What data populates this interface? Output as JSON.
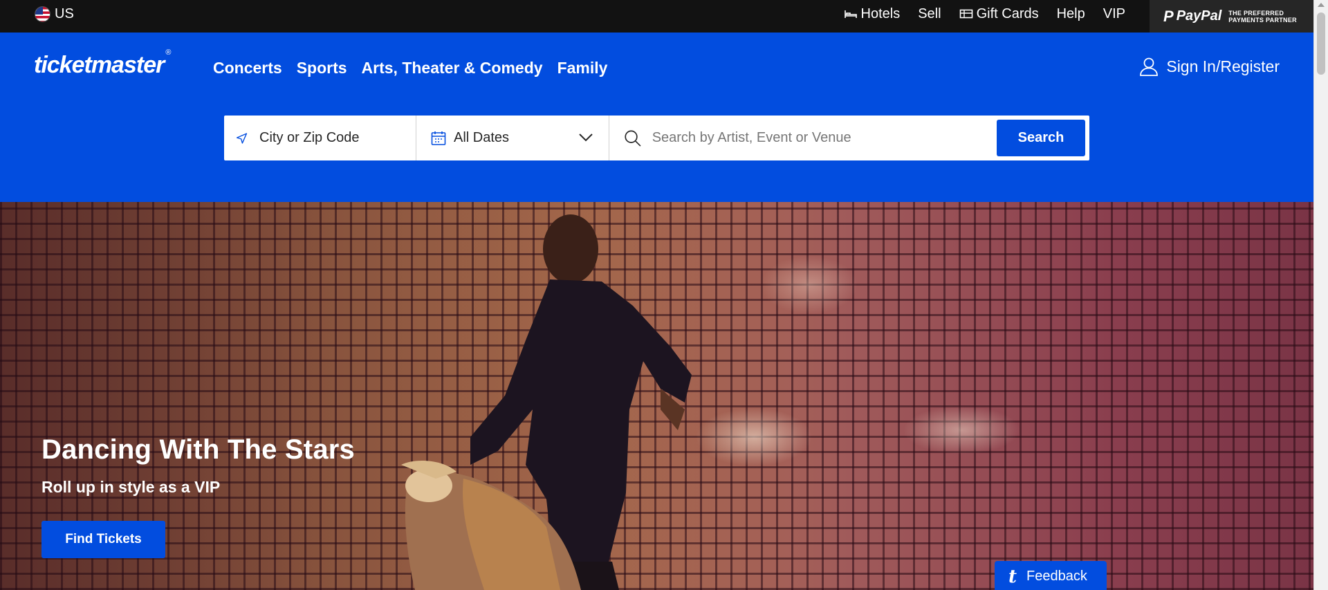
{
  "topbar": {
    "locale": "US",
    "links": [
      "Hotels",
      "Sell",
      "Gift Cards",
      "Help",
      "VIP"
    ],
    "paypal": {
      "logo": "PayPal",
      "tagline_1": "THE PREFERRED",
      "tagline_2": "PAYMENTS PARTNER"
    }
  },
  "header": {
    "logo": "ticketmaster",
    "logo_mark": "®",
    "nav": [
      "Concerts",
      "Sports",
      "Arts, Theater & Comedy",
      "Family"
    ],
    "signin": "Sign In/Register"
  },
  "search": {
    "location_placeholder": "City or Zip Code",
    "dates_value": "All Dates",
    "query_placeholder": "Search by Artist, Event or Venue",
    "button": "Search"
  },
  "hero": {
    "title": "Dancing With The Stars",
    "subtitle": "Roll up in style as a VIP",
    "cta": "Find Tickets"
  },
  "feedback": {
    "icon": "t",
    "label": "Feedback"
  },
  "colors": {
    "brand_blue": "#024ddf",
    "topbar": "#121212"
  }
}
